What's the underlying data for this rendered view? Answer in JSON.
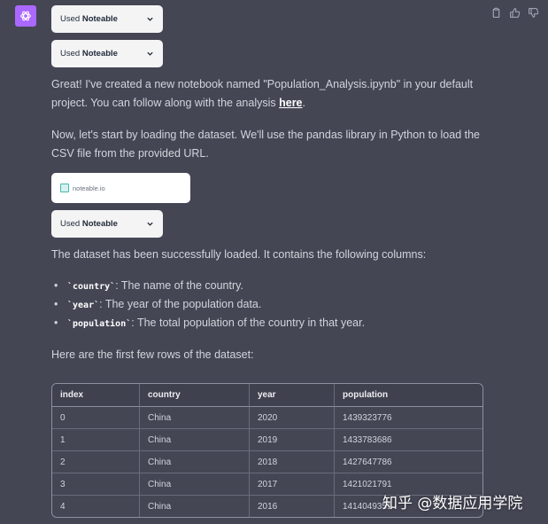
{
  "tool_calls": [
    {
      "prefix": "Used ",
      "name": "Noteable"
    },
    {
      "prefix": "Used ",
      "name": "Noteable"
    },
    {
      "prefix": "Used ",
      "name": "Noteable"
    }
  ],
  "messages": {
    "p1_pre": "Great! I've created a new notebook named \"Population_Analysis.ipynb\" in your default project. You can follow along with the analysis ",
    "p1_link": "here",
    "p1_post": ".",
    "p2": "Now, let's start by loading the dataset. We'll use the pandas library in Python to load the CSV file from the provided URL.",
    "p3": "The dataset has been successfully loaded. It contains the following columns:",
    "p4": "Here are the first few rows of the dataset:"
  },
  "link_card": {
    "domain": "noteable.io"
  },
  "columns": [
    {
      "code": "`country`",
      "desc": ": The name of the country."
    },
    {
      "code": "`year`",
      "desc": ": The year of the population data."
    },
    {
      "code": "`population`",
      "desc": ": The total population of the country in that year."
    }
  ],
  "table": {
    "headers": [
      "index",
      "country",
      "year",
      "population"
    ],
    "rows": [
      [
        "0",
        "China",
        "2020",
        "1439323776"
      ],
      [
        "1",
        "China",
        "2019",
        "1433783686"
      ],
      [
        "2",
        "China",
        "2018",
        "1427647786"
      ],
      [
        "3",
        "China",
        "2017",
        "1421021791"
      ],
      [
        "4",
        "China",
        "2016",
        "1414049351"
      ]
    ]
  },
  "watermark": "知乎 @数据应用学院",
  "colors": {
    "background": "#444654",
    "avatar": "#ab68ff",
    "chip": "#f4f4f5"
  },
  "icons": [
    "openai-logo-icon",
    "copy-icon",
    "thumbs-up-icon",
    "thumbs-down-icon",
    "chevron-down-icon",
    "favicon-icon"
  ]
}
